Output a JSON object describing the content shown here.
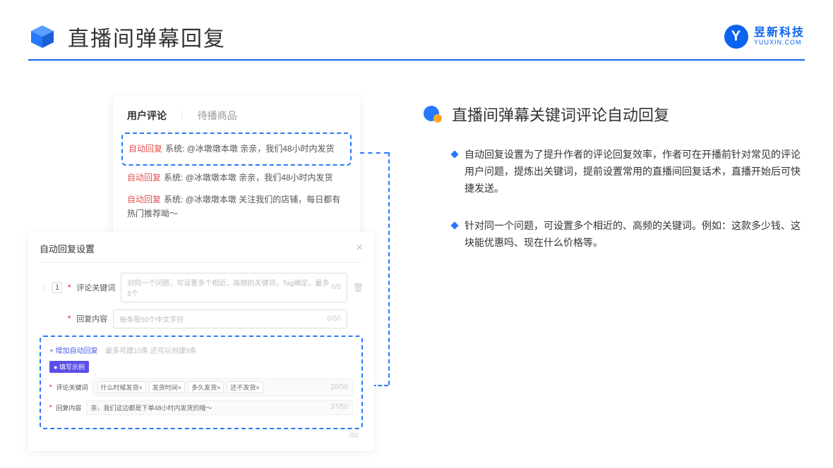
{
  "header": {
    "title": "直播间弹幕回复",
    "brand_name": "昱新科技",
    "brand_url": "YUUXIN.COM"
  },
  "comments": {
    "tab_active": "用户评论",
    "tab_inactive": "待播商品",
    "label": "自动回复",
    "items": [
      "系统: @冰墩墩本墩 亲亲，我们48小时内发货",
      "系统: @冰墩墩本墩 亲亲，我们48小时内发货",
      "系统: @冰墩墩本墩 关注我们的店铺，每日都有热门推荐呦～"
    ]
  },
  "settings": {
    "title": "自动回复设置",
    "row_num": "1",
    "keyword_label": "评论关键词",
    "keyword_placeholder": "对同一个问题，可设置多个相近、高频的关键词，Tag确定，最多5个",
    "keyword_counter": "0/5",
    "reply_label": "回复内容",
    "reply_placeholder": "每条限50个中文字符",
    "reply_counter": "0/50",
    "add_link": "+ 增加自动回复",
    "add_hint": "最多可建10条 还可以创建9条",
    "example_badge": "● 填写示例",
    "ex_keyword_label": "评论关键词",
    "ex_tags": [
      "什么时候发货×",
      "发货时间×",
      "多久发货×",
      "还不发货×"
    ],
    "ex_keyword_counter": "20/50",
    "ex_reply_label": "回复内容",
    "ex_reply_text": "亲，我们这边都是下单48小时内发货的哦～",
    "ex_reply_counter": "37/50",
    "footer_counter": "/50"
  },
  "right": {
    "section_title": "直播间弹幕关键词评论自动回复",
    "bullets": [
      "自动回复设置为了提升作者的评论回复效率，作者可在开播前针对常见的评论用户问题，提炼出关键词，提前设置常用的直播间回复话术，直播开始后可快捷发送。",
      "针对同一个问题，可设置多个相近的、高频的关键词。例如：这款多少钱、这块能优惠吗、现在什么价格等。"
    ]
  }
}
